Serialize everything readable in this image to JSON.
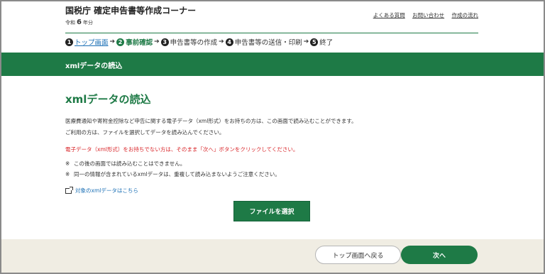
{
  "header": {
    "site_title": "国税庁 確定申告書等作成コーナー",
    "era_prefix": "令和",
    "era_number": "6",
    "era_suffix": "年分",
    "links": [
      "よくある質問",
      "お問い合わせ",
      "作成の流れ"
    ]
  },
  "steps": [
    {
      "num": "1",
      "label": "トップ画面"
    },
    {
      "num": "2",
      "label": "事前確認"
    },
    {
      "num": "3",
      "label": "申告書等の作成"
    },
    {
      "num": "4",
      "label": "申告書等の送信・印刷"
    },
    {
      "num": "5",
      "label": "終了"
    }
  ],
  "banner": {
    "title": "xmlデータの読込"
  },
  "main": {
    "title": "xmlデータの読込",
    "intro_line1": "医療費通知や寄附金控除など申告に関する電子データ（xml形式）をお持ちの方は、この画面で読み込むことができます。",
    "intro_line2": "ご利用の方は、ファイルを選択してデータを読み込んでください。",
    "warning": "電子データ（xml形式）をお持ちでない方は、そのまま「次へ」ボタンをクリックしてください。",
    "note_mark": "※",
    "note1": "この後の画面では読み込むことはできません。",
    "note2": "同一の情報が含まれているxmlデータは、重複して読み込まないようご注意ください。",
    "link_label": "対象のxmlデータはこちら",
    "file_button": "ファイルを選択"
  },
  "footer": {
    "back_button": "トップ画面へ戻る",
    "next_button": "次へ"
  },
  "colors": {
    "brand_green": "#1e7a46",
    "warning_red": "#d9262a",
    "link_blue": "#1a6fb5",
    "footer_bg": "#f0ede3"
  }
}
